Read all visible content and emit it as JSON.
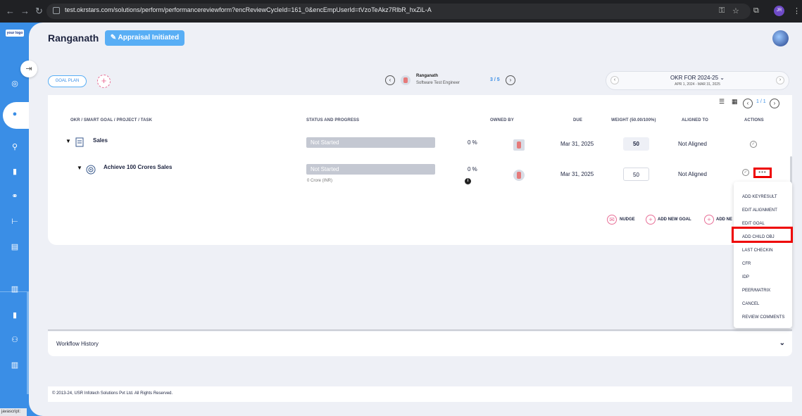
{
  "browser": {
    "url": "test.okrstars.com/solutions/perform/performancereviewform?encReviewCycleId=161_0&encEmpUserId=tVzoTeAkz7RlbR_hxZiL-A",
    "profile_initials": "JR",
    "status_text": "javascript:"
  },
  "sidebar": {
    "logo_text": "your logo",
    "icons": [
      "target-icon",
      "team-icon",
      "person-tree-icon",
      "book-icon",
      "handshake-icon",
      "hierarchy-icon",
      "form-icon",
      "report-icon",
      "book-icon",
      "people-icon",
      "chart-icon"
    ]
  },
  "header": {
    "employee_name": "Ranganath",
    "status_button": "Appraisal Initiated"
  },
  "toolbar": {
    "goal_plan_label": "GOAL PLAN",
    "pager_name": "Ranganath",
    "pager_role": "Software Test Engineer",
    "pager_count": "3 / 5",
    "okr_title": "OKR FOR 2024-25",
    "okr_dates": "APR 1, 2024 - MAR 31, 2025",
    "page_indicator": "1 / 1"
  },
  "table": {
    "headers": {
      "goal": "OKR / SMART GOAL / PROJECT / TASK",
      "status": "STATUS AND PROGRESS",
      "owned": "OWNED BY",
      "due": "DUE",
      "weight": "WEIGHT (50.00/100%)",
      "aligned": "ALIGNED TO",
      "actions": "ACTIONS"
    },
    "rows": [
      {
        "title": "Sales",
        "status": "Not Started",
        "progress": "0 %",
        "due": "Mar 31, 2025",
        "weight": "50",
        "aligned": "Not Aligned"
      },
      {
        "title": "Achieve 100 Crores Sales",
        "status": "Not Started",
        "progress": "0 %",
        "sub": "0 Crore (INR)",
        "due": "Mar 31, 2025",
        "weight": "50",
        "aligned": "Not Aligned"
      }
    ],
    "progress_values": [
      0,
      0
    ]
  },
  "footer_actions": {
    "nudge": "NUDGE",
    "add_new_goal": "ADD NEW GOAL",
    "add_new_other": "ADD NE"
  },
  "context_menu": {
    "items": [
      "ADD KEYRESULT",
      "EDIT ALIGNMENT",
      "EDIT GOAL",
      "ADD CHILD OBJ",
      "LAST CHECKIN",
      "CFR",
      "IDP",
      "PEER/MATRIX",
      "CANCEL",
      "REVIEW COMMENTS"
    ],
    "highlighted": "ADD CHILD OBJ"
  },
  "workflow": {
    "label": "Workflow History"
  },
  "footer": {
    "copyright": "© 2013-24, USR Infotech Solutions Pvt Ltd. All Rights Reserved."
  },
  "colors": {
    "accent": "#3a8ee6",
    "button": "#58aef5",
    "highlight": "#ee0000",
    "pink": "#e86f97"
  }
}
